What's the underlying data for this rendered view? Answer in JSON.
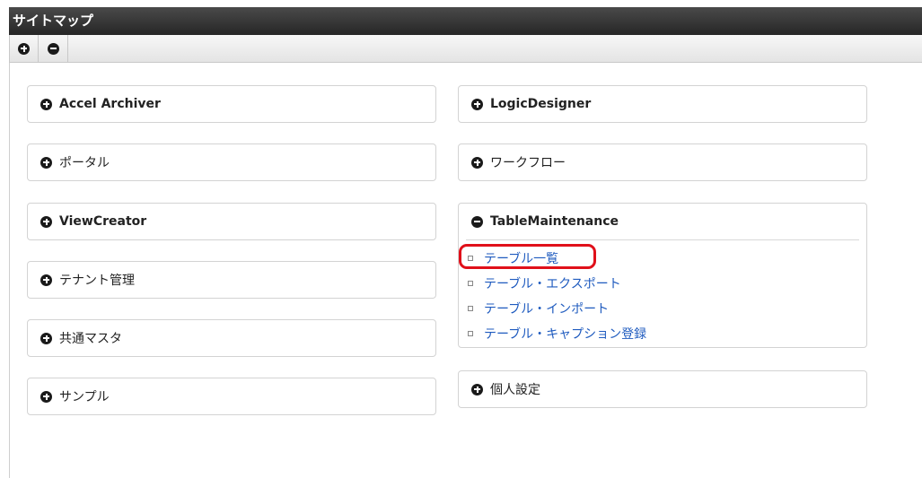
{
  "window": {
    "title": "サイトマップ"
  },
  "toolbar": {
    "expand_icon": "plus-circle-icon",
    "collapse_icon": "minus-circle-icon"
  },
  "left_column": [
    {
      "title": "Accel Archiver",
      "icon": "plus-circle-icon"
    },
    {
      "title": "ポータル",
      "icon": "plus-circle-icon"
    },
    {
      "title": "ViewCreator",
      "icon": "plus-circle-icon"
    },
    {
      "title": "テナント管理",
      "icon": "plus-circle-icon"
    },
    {
      "title": "共通マスタ",
      "icon": "plus-circle-icon"
    },
    {
      "title": "サンプル",
      "icon": "plus-circle-icon"
    }
  ],
  "right_column": [
    {
      "title": "LogicDesigner",
      "icon": "plus-circle-icon"
    },
    {
      "title": "ワークフロー",
      "icon": "plus-circle-icon"
    },
    {
      "title": "TableMaintenance",
      "icon": "minus-circle-icon",
      "items": [
        {
          "label": "テーブル一覧"
        },
        {
          "label": "テーブル・エクスポート"
        },
        {
          "label": "テーブル・インポート"
        },
        {
          "label": "テーブル・キャプション登録"
        }
      ]
    },
    {
      "title": "個人設定",
      "icon": "plus-circle-icon"
    }
  ],
  "annotation": {
    "color": "#e0101a"
  }
}
